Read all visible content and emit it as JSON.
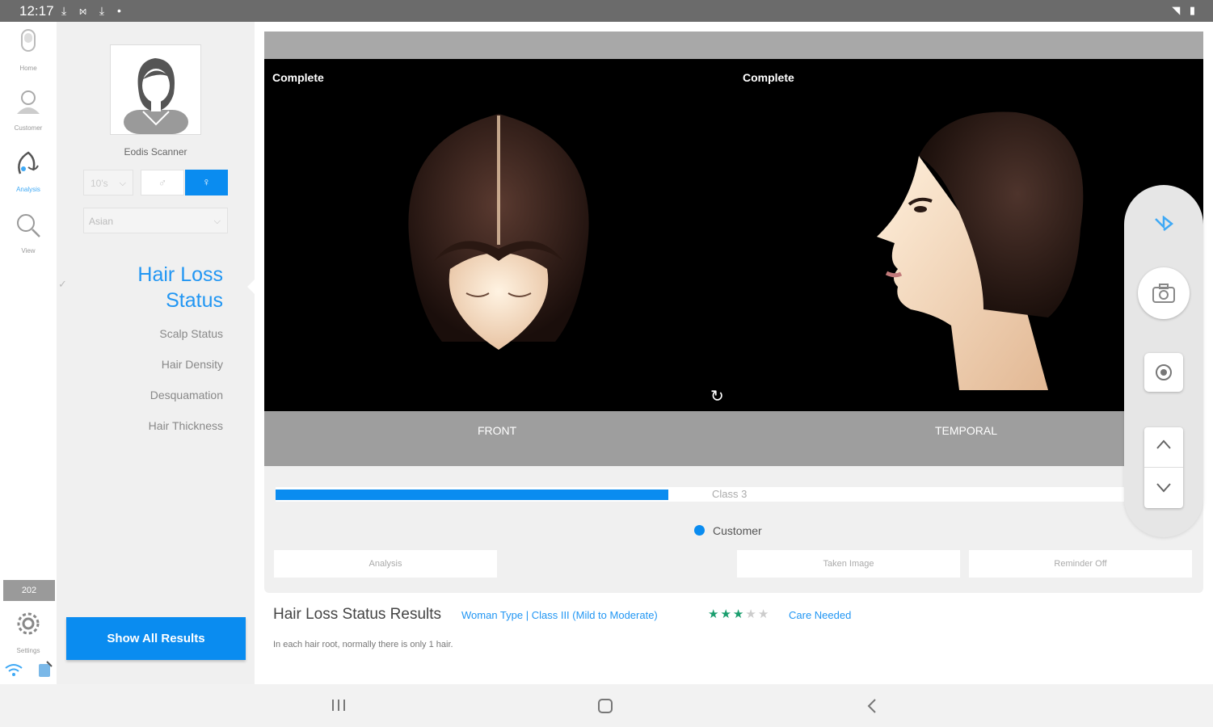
{
  "status_bar": {
    "time": "12:17",
    "left_icons": "⤓ ⋈ ⤓ •",
    "right_icons": "◥ ▮"
  },
  "rail": {
    "items": [
      {
        "label": "Home",
        "icon": "scanner-icon"
      },
      {
        "label": "Customer",
        "icon": "customer-icon"
      },
      {
        "label": "Analysis",
        "icon": "analysis-icon"
      },
      {
        "label": "View",
        "icon": "search-icon"
      }
    ],
    "counter": "202",
    "settings_label": "Settings"
  },
  "profile": {
    "device_name": "Eodis Scanner",
    "age_value": "10's",
    "race_value": "Asian",
    "gender_male_symbol": "♂",
    "gender_female_symbol": "♀"
  },
  "menu": {
    "title_line1": "Hair Loss",
    "title_line2": "Status",
    "items": [
      "Scalp Status",
      "Hair Density",
      "Desquamation",
      "Hair Thickness"
    ]
  },
  "show_all_button": "Show All Results",
  "viewer": {
    "left_status": "Complete",
    "right_status": "Complete",
    "front_label": "FRONT",
    "temporal_label": "TEMPORAL"
  },
  "progress": {
    "label": "Class 3",
    "value_fraction": 0.463
  },
  "legend": {
    "label": "Customer"
  },
  "tabs": [
    "Analysis",
    "Taken Image",
    "Reminder Off"
  ],
  "results": {
    "title": "Hair Loss Status Results",
    "type_text": "Woman Type | Class III (Mild to Moderate)",
    "stars_filled": 3,
    "stars_total": 5,
    "care_text": "Care Needed",
    "description": "In each hair root, normally there is only 1 hair."
  },
  "colors": {
    "accent": "#0a8cf0",
    "star": "#1a9e6e",
    "star_off": "#cccccc"
  }
}
